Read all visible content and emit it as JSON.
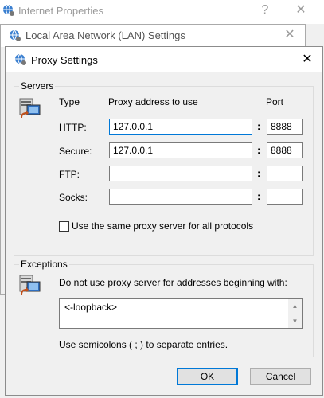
{
  "windows": {
    "internet_properties": {
      "title": "Internet Properties",
      "help_glyph": "?",
      "close_glyph": "✕"
    },
    "lan_settings": {
      "title": "Local Area Network (LAN) Settings",
      "close_glyph": "✕"
    },
    "proxy_settings": {
      "title": "Proxy Settings",
      "close_glyph": "✕"
    }
  },
  "servers": {
    "group_label": "Servers",
    "col_type": "Type",
    "col_address": "Proxy address to use",
    "col_port": "Port",
    "colon": ":",
    "rows": [
      {
        "type": "HTTP:",
        "address": "127.0.0.1",
        "port": "8888"
      },
      {
        "type": "Secure:",
        "address": "127.0.0.1",
        "port": "8888"
      },
      {
        "type": "FTP:",
        "address": "",
        "port": ""
      },
      {
        "type": "Socks:",
        "address": "",
        "port": ""
      }
    ],
    "same_proxy_label": "Use the same proxy server for all protocols",
    "same_proxy_checked": false
  },
  "exceptions": {
    "group_label": "Exceptions",
    "instruction": "Do not use proxy server for addresses beginning with:",
    "value": "<-loopback>",
    "hint": "Use semicolons ( ; ) to separate entries."
  },
  "buttons": {
    "ok": "OK",
    "cancel": "Cancel"
  },
  "icons": {
    "window": "globe-gear-icon",
    "servers": "server-computer-icon",
    "exceptions": "server-computer-icon"
  }
}
